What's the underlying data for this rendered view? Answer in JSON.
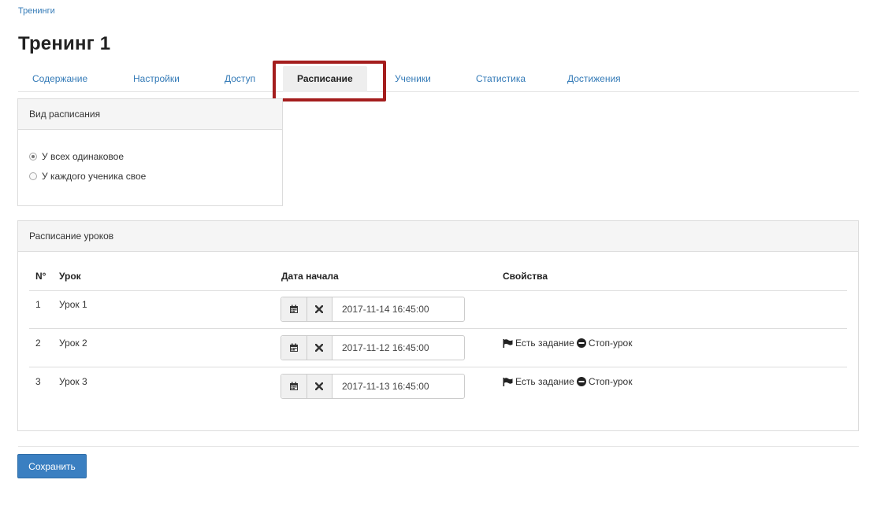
{
  "breadcrumb": "Тренинги",
  "title": "Тренинг 1",
  "tabs": [
    {
      "label": "Содержание"
    },
    {
      "label": "Настройки"
    },
    {
      "label": "Доступ"
    },
    {
      "label": "Расписание"
    },
    {
      "label": "Ученики"
    },
    {
      "label": "Статистика"
    },
    {
      "label": "Достижения"
    }
  ],
  "active_tab": "Расписание",
  "schedule_type": {
    "heading": "Вид расписания",
    "options": [
      {
        "label": "У всех одинаковое",
        "checked": true
      },
      {
        "label": "У каждого ученика свое",
        "checked": false
      }
    ]
  },
  "lessons": {
    "heading": "Расписание уроков",
    "columns": {
      "num": "N°",
      "lesson": "Урок",
      "start_date": "Дата начала",
      "properties": "Свойства"
    },
    "rows": [
      {
        "num": "1",
        "lesson": "Урок 1",
        "date": "2017-11-14 16:45:00",
        "has_task": "",
        "stop": ""
      },
      {
        "num": "2",
        "lesson": "Урок 2",
        "date": "2017-11-12 16:45:00",
        "has_task": "Есть задание",
        "stop": "Стоп-урок"
      },
      {
        "num": "3",
        "lesson": "Урок 3",
        "date": "2017-11-13 16:45:00",
        "has_task": "Есть задание",
        "stop": "Стоп-урок"
      }
    ]
  },
  "save_label": "Сохранить",
  "colors": {
    "link": "#337ab7",
    "highlight": "#a41d1d",
    "primary_button": "#3a7fc1"
  },
  "icons": [
    "calendar-icon",
    "clear-icon",
    "flag-icon",
    "stop-icon"
  ]
}
